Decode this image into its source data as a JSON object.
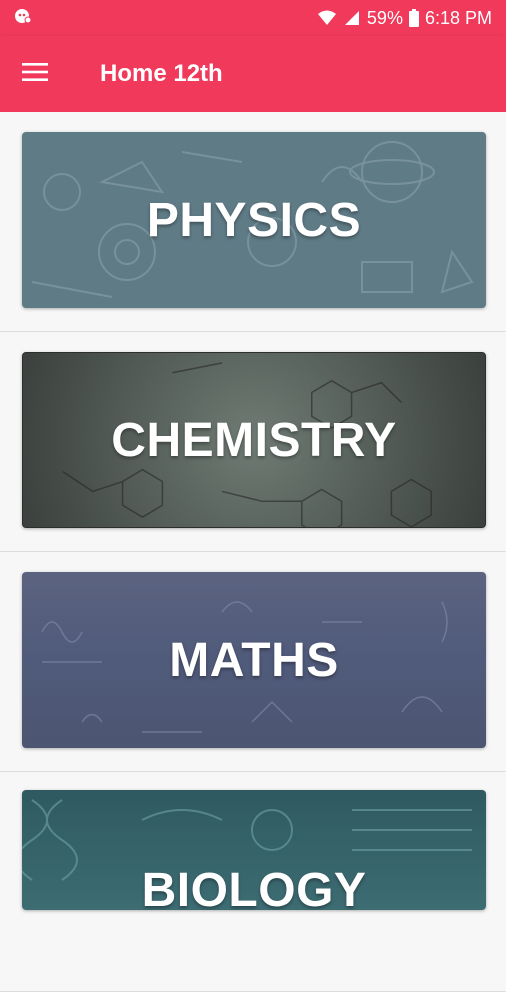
{
  "status": {
    "battery": "59%",
    "time": "6:18 PM"
  },
  "appbar": {
    "title": "Home 12th"
  },
  "subjects": [
    {
      "label": "PHYSICS"
    },
    {
      "label": "CHEMISTRY"
    },
    {
      "label": "MATHS"
    },
    {
      "label": "BIOLOGY"
    }
  ],
  "colors": {
    "primary": "#f0395b"
  }
}
